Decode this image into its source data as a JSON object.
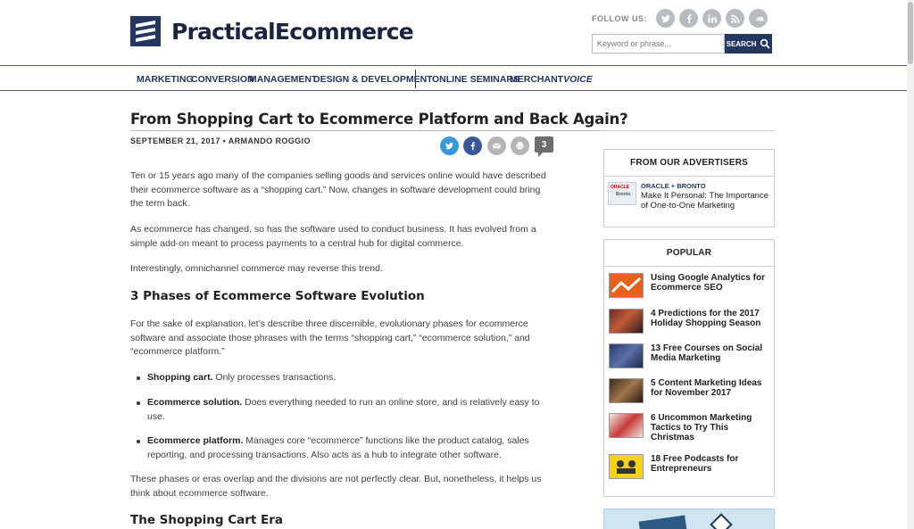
{
  "brand": {
    "logo_text": "PracticalEcommerce",
    "primary_color": "#24375e"
  },
  "header": {
    "follow_label": "FOLLOW US:",
    "social_icons": [
      "twitter-icon",
      "facebook-icon",
      "linkedin-icon",
      "rss-icon",
      "soundcloud-icon"
    ],
    "search_placeholder": "Keyword or phrase...",
    "search_button": "SEARCH"
  },
  "nav": {
    "items": [
      "MARKETING",
      "CONVERSION",
      "MANAGEMENT",
      "DESIGN & DEVELOPMENT",
      "ONLINE SEMINARS"
    ],
    "merchant": "MERCHANT",
    "voice": "VOICE"
  },
  "article": {
    "title": "From Shopping Cart to Ecommerce Platform and Back Again?",
    "byline": "SEPTEMBER 21, 2017 • ARMANDO ROGGIO",
    "share_icons": [
      "twitter-icon",
      "facebook-icon",
      "email-icon",
      "print-icon"
    ],
    "comment_count": "3",
    "paragraphs": [
      "Ten or 15 years ago many of the companies selling goods and services online would have described their ecommerce software as a “shopping cart.” Now, changes in software development could bring the term back.",
      "As ecommerce has changed, so has the software used to conduct business. It has evolved from a simple add-on meant to process payments to a central hub for digital commerce.",
      "Interestingly, omnichannel commerce may reverse this trend.",
      "For the sake of explanation, let’s describe three discernible, evolutionary phases for ecommerce software and associate those phrases with the terms “shopping cart,” “ecommerce solution,” and “ecommerce platform.”",
      "These phases or eras overlap and the divisions are not perfectly clear. But, nonetheless, it helps us think about ecommerce software."
    ],
    "heading_1": "3 Phases of Ecommerce Software Evolution",
    "heading_2": "The Shopping Cart Era",
    "list": [
      {
        "term": "Shopping cart.",
        "text": " Only processes transactions."
      },
      {
        "term": "Ecommerce solution.",
        "text": " Does everything needed to run an online store, and is relatively easy to use."
      },
      {
        "term": "Ecommerce platform.",
        "text": " Manages core “ecommerce” functions like the product catalog, sales reporting, and processing transactions. Also acts as a hub to integrate other software."
      }
    ]
  },
  "sidebar": {
    "advertisers_heading": "FROM OUR ADVERTISERS",
    "advertiser": {
      "brand": "ORACLE + BRONTO",
      "title": "Make It Personal: The Importance of One-to-One Marketing",
      "thumb_oracle": "ORACLE",
      "thumb_bronto": "Bronto"
    },
    "popular_heading": "POPULAR",
    "popular": [
      {
        "title": "Using Google Analytics for Ecommerce SEO"
      },
      {
        "title": "4 Predictions for the 2017 Holiday Shopping Season"
      },
      {
        "title": "13 Free Courses on Social Media Marketing"
      },
      {
        "title": "5 Content Marketing Ideas for November 2017"
      },
      {
        "title": "6 Uncommon Marketing Tactics to Try This Christmas"
      },
      {
        "title": "18 Free Podcasts for Entrepreneurs"
      }
    ]
  }
}
